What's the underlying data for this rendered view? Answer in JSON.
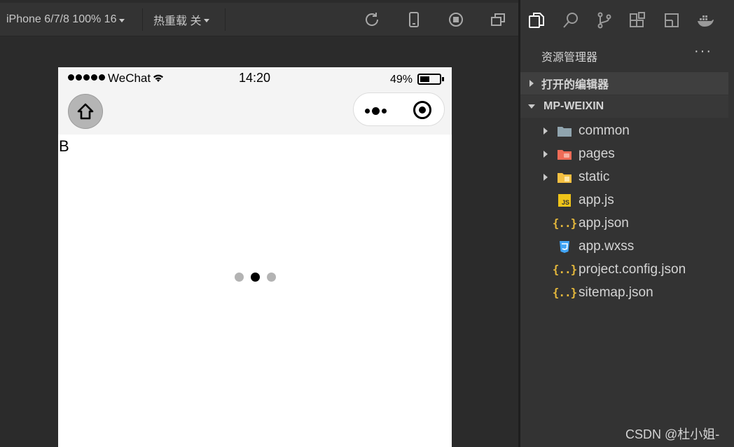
{
  "toolbar": {
    "device_label": "iPhone 6/7/8 100% 16",
    "hot_reload_label": "热重载 关"
  },
  "phone": {
    "status": {
      "carrier": "WeChat",
      "time": "14:20",
      "battery": "49%",
      "battery_level": 0.49
    },
    "page_text": "B"
  },
  "explorer": {
    "title": "资源管理器",
    "more": "···",
    "open_editors": "打开的编辑器",
    "project_name": "MP-WEIXIN",
    "tree": [
      {
        "name": "common",
        "type": "folder",
        "icon": "folder-icon",
        "color": "#90a4ae"
      },
      {
        "name": "pages",
        "type": "folder",
        "icon": "folder-pages-icon",
        "color": "#ef6c57"
      },
      {
        "name": "static",
        "type": "folder",
        "icon": "folder-static-icon",
        "color": "#f5c042"
      },
      {
        "name": "app.js",
        "type": "file",
        "icon": "js-file-icon",
        "color": "#f0c419"
      },
      {
        "name": "app.json",
        "type": "file",
        "icon": "json-file-icon",
        "color": "#e6b93c"
      },
      {
        "name": "app.wxss",
        "type": "file",
        "icon": "css-file-icon",
        "color": "#42a5f5"
      },
      {
        "name": "project.config.json",
        "type": "file",
        "icon": "json-file-icon",
        "color": "#e6b93c"
      },
      {
        "name": "sitemap.json",
        "type": "file",
        "icon": "json-file-icon",
        "color": "#e6b93c"
      }
    ]
  },
  "watermark": "CSDN @杜小姐-"
}
